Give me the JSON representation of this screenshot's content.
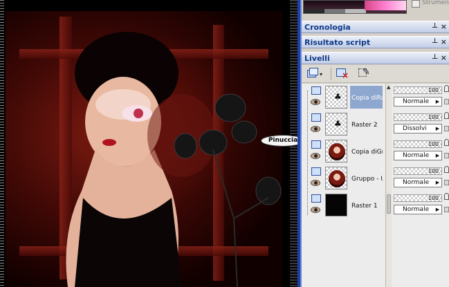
{
  "checkbox": {
    "label": "Strument",
    "checked": false
  },
  "palettes": {
    "cronologia": {
      "title": "Cronologia"
    },
    "risultato_script": {
      "title": "Risultato script"
    },
    "livelli": {
      "title": "Livelli"
    }
  },
  "header_icons": {
    "pin": "pin-icon",
    "close": "close-icon"
  },
  "layers": [
    {
      "name": "Copia diRa",
      "opacity": "100",
      "blend": "Normale",
      "thumb": "transparent-brush",
      "selected": true
    },
    {
      "name": "Raster 2",
      "opacity": "100",
      "blend": "Dissolvi",
      "thumb": "transparent-brush",
      "selected": false
    },
    {
      "name": "Copia diGr",
      "opacity": "100",
      "blend": "Normale",
      "thumb": "portrait",
      "selected": false
    },
    {
      "name": "Gruppo - U",
      "opacity": "100",
      "blend": "Normale",
      "thumb": "portrait",
      "selected": false
    },
    {
      "name": "Raster 1",
      "opacity": "100",
      "blend": "Normale",
      "thumb": "black",
      "selected": false
    }
  ],
  "watermark": "Pinuccia",
  "colors": {
    "panel_bg": "#d4d0c8",
    "header_text": "#103a8a",
    "selection": "#8ea7cf",
    "window_border": "#1f3fa8"
  }
}
